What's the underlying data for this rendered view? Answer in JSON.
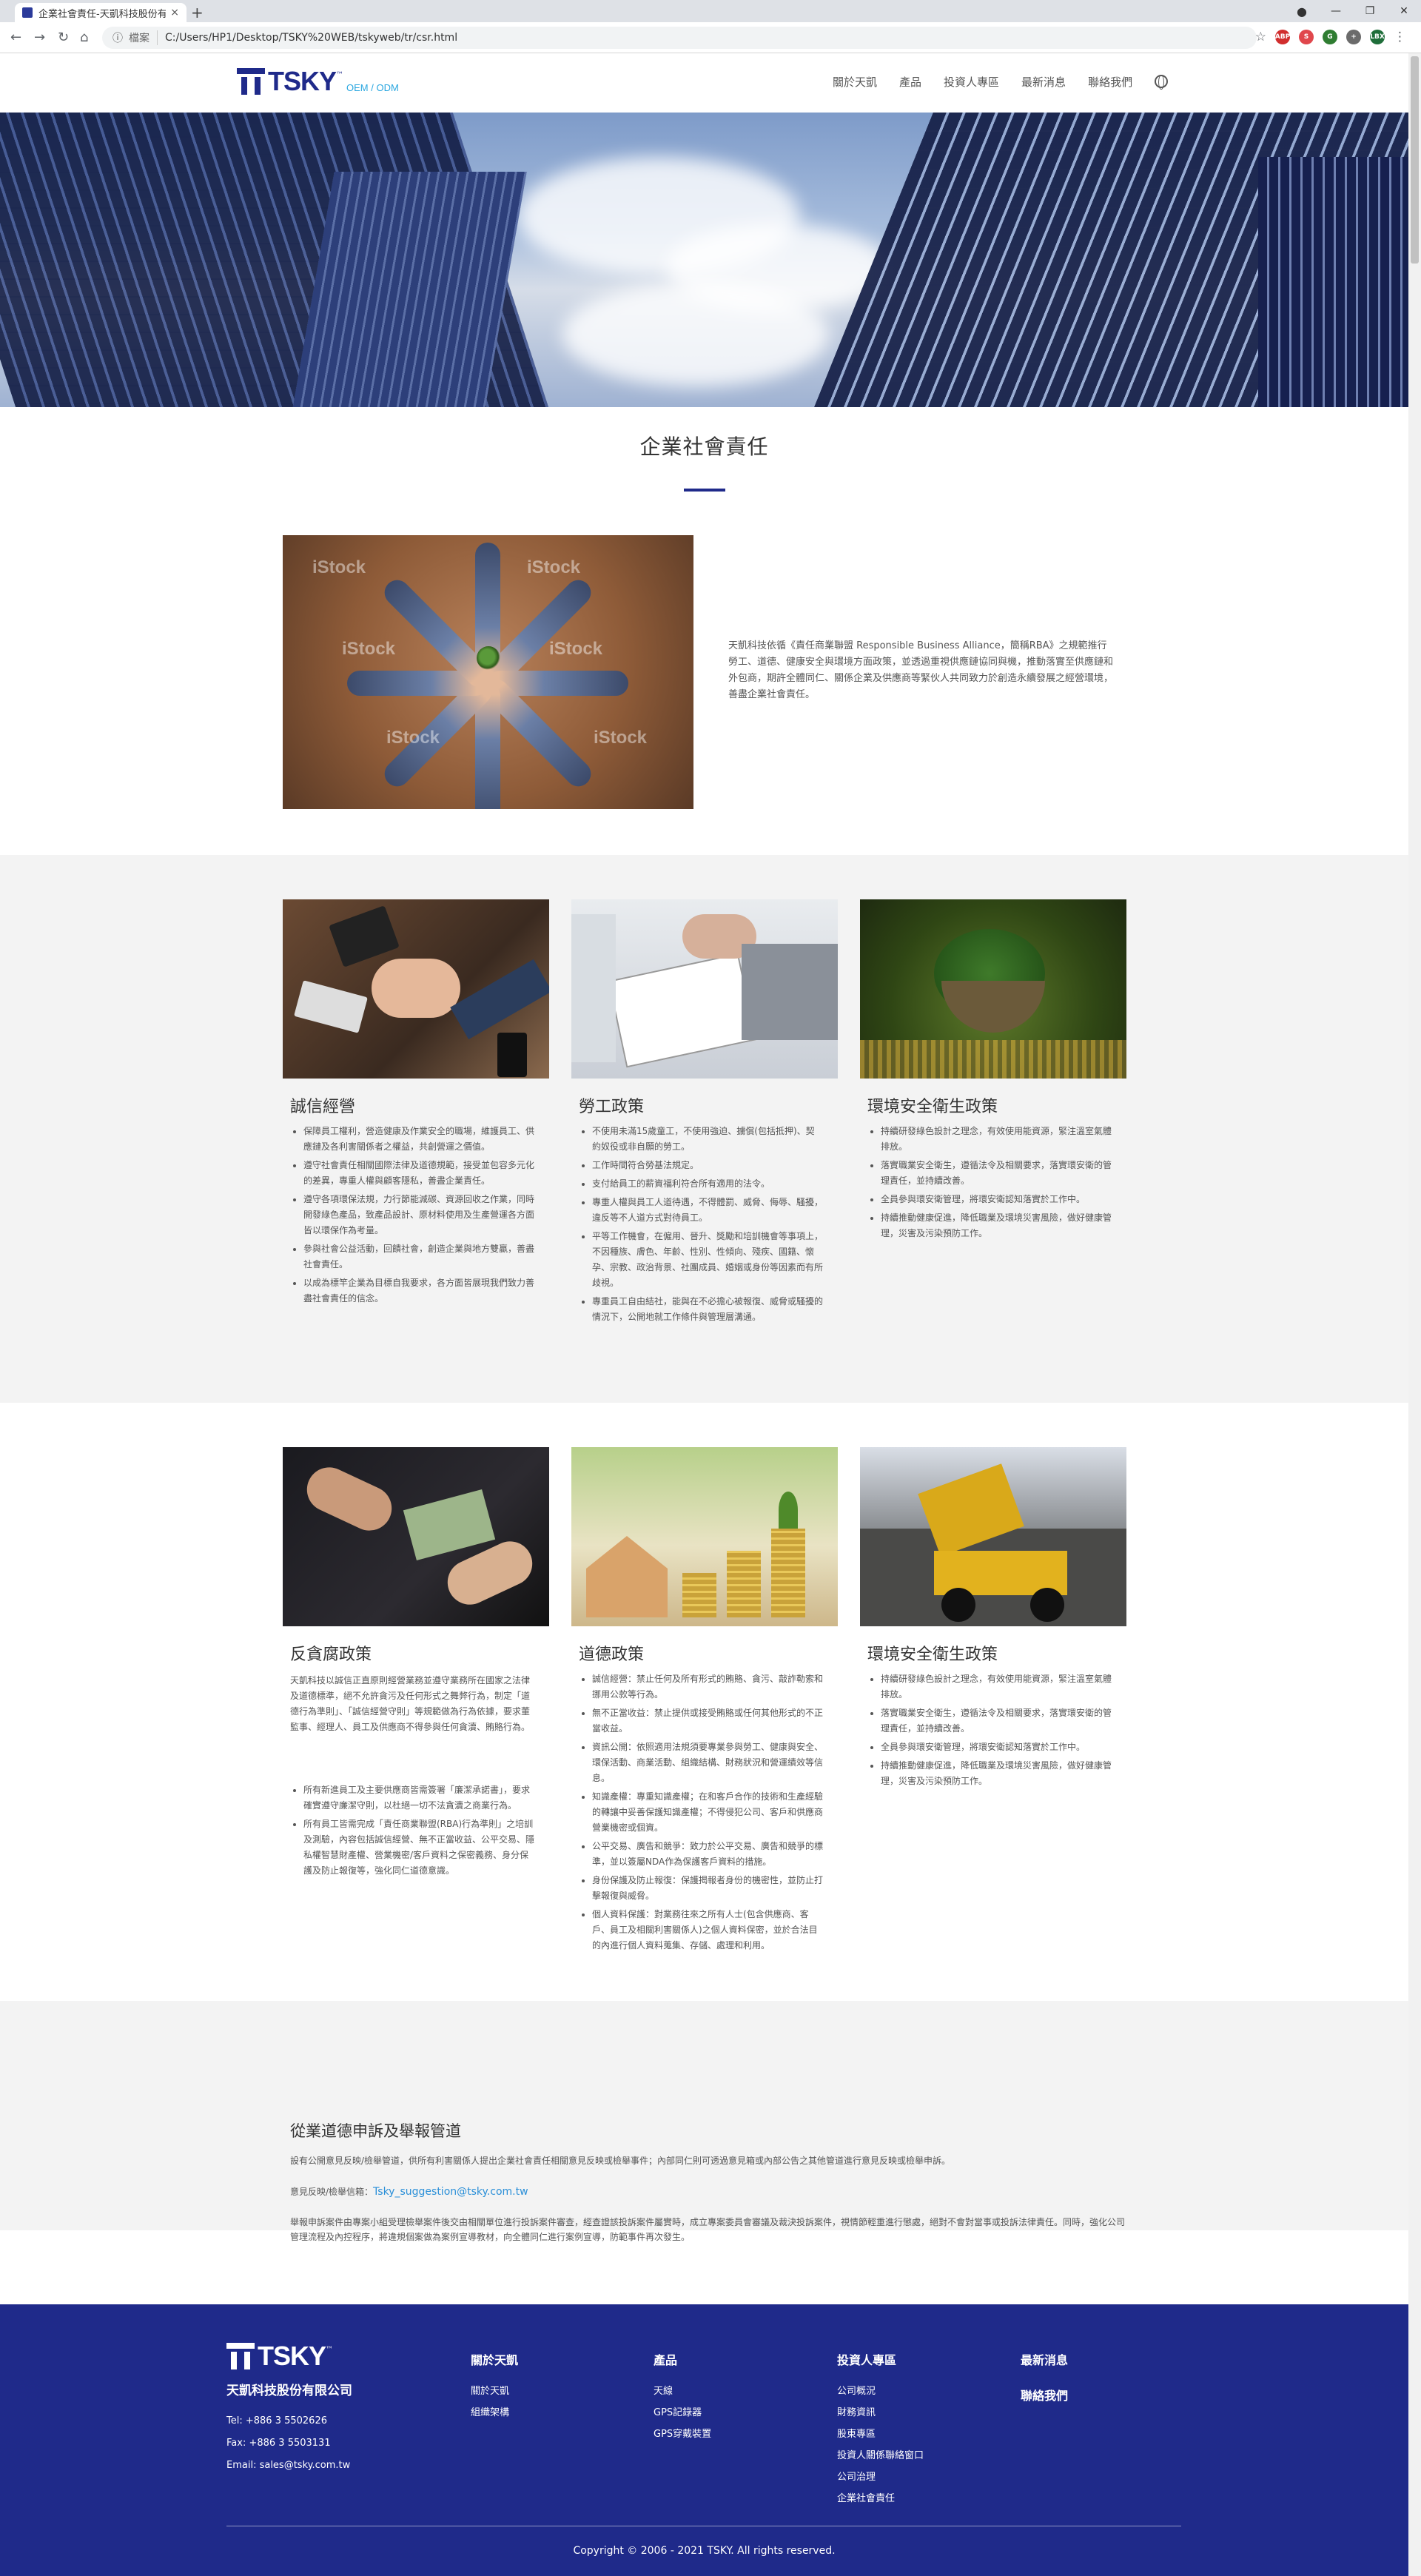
{
  "browser": {
    "tab_title": "企業社會責任-天凱科技股份有限",
    "tab_close": "×",
    "new_tab": "+",
    "site_label": "檔案",
    "url": "C:/Users/HP1/Desktop/TSKY%20WEB/tskyweb/tr/csr.html",
    "extensions": [
      {
        "name": "ABP",
        "color": "#d12e2e"
      },
      {
        "name": "S",
        "color": "#e0474c"
      },
      {
        "name": "G",
        "color": "#2f7d32"
      },
      {
        "name": "+",
        "color": "#6b6b6b"
      },
      {
        "name": "LBX",
        "color": "#1f6e3a"
      }
    ]
  },
  "header": {
    "logo_text": "TSKY",
    "logo_tm": "™",
    "logo_sub": "OEM / ODM",
    "nav": [
      "關於天凱",
      "產品",
      "投資人專區",
      "最新消息",
      "聯絡我們"
    ]
  },
  "hero": {
    "watermark": "iStock"
  },
  "page_title": "企業社會責任",
  "intro": {
    "text": "天凱科技依循《責任商業聯盟 Responsible Business Alliance，簡稱RBA》之規範推行勞工、道德、健康安全與環境方面政策，並透過重視供應鏈協同與機，推動落實至供應鏈和外包商，期許全體同仁、關係企業及供應商等緊伙人共同致力於創造永續發展之經營環境，善盡企業社會責任。"
  },
  "cards_row1": [
    {
      "title": "誠信經營",
      "items": [
        "保障員工權利，營造健康及作業安全的職場，維護員工、供應鏈及各利害關係者之權益，共創營運之價值。",
        "遵守社會責任相關國際法律及道德規範，接受並包容多元化的差異，專重人權與顧客隱私，善盡企業責任。",
        "遵守各項環保法規，力行節能減碳、資源回收之作業，同時開發綠色產品，致產品設計、原材料使用及生產營運各方面皆以環保作為考量。",
        "參與社會公益活動，回饋社會，創造企業與地方雙贏，善盡社會責任。",
        "以成為標竿企業為目標自我要求，各方面皆展現我們致力善盡社會責任的信念。"
      ]
    },
    {
      "title": "勞工政策",
      "items": [
        "不使用未滿15歲童工，不使用強迫、擄償(包括抵押)、契約奴役或非自願的勞工。",
        "工作時間符合勞基法規定。",
        "支付給員工的薪資福利符合所有適用的法令。",
        "專重人權與員工人道待遇，不得體罰、威脅、侮辱、騷擾，違反等不人道方式對待員工。",
        "平等工作機會，在僱用、晉升、獎勵和培訓機會等事項上，不因種族、膚色、年齡、性別、性傾向、殘疾、國籍、懷孕、宗教、政治背景、社團成員、婚姻或身份等因素而有所歧視。",
        "專重員工自由結社，能與在不必擔心被報復、威脅或騷擾的情況下，公開地就工作條件與管理層溝通。"
      ]
    },
    {
      "title": "環境安全衛生政策",
      "items": [
        "持續研發綠色設計之理念，有效使用能資源，緊注溫室氣體排放。",
        "落實職業安全衛生，遵循法令及相關要求，落實環安衛的管理責任，並持續改善。",
        "全員參與環安衛管理，將環安衛認知落實於工作中。",
        "持續推動健康促進，降低職業及環境災害風險，做好健康管理，災害及污染預防工作。"
      ]
    }
  ],
  "cards_row2": [
    {
      "title": "反貪腐政策",
      "paragraph": "天凱科技以誠信正直原則經營業務並遵守業務所在國家之法律及道德標準，絕不允許貪污及任何形式之舞弊行為，制定「道德行為準則」、「誠信經營守則」等規範做為行為依據，要求董監事、經理人、員工及供應商不得參與任何貪瀆、賄賂行為。",
      "items": [
        "所有新進員工及主要供應商皆需簽署「廉潔承諾書」，要求確實遵守廉潔守則，以杜絕一切不法貪瀆之商業行為。",
        "所有員工皆需完成「責任商業聯盟(RBA)行為準則」之培訓及測驗，內容包括誠信經營、無不正當收益、公平交易、隱私權智慧財產權、營業機密/客戶資料之保密義務、身分保護及防止報復等，強化同仁道德意識。"
      ]
    },
    {
      "title": "道德政策",
      "items": [
        "誠信經營：禁止任何及所有形式的賄賂、貪污、敲詐勒索和挪用公款等行為。",
        "無不正當收益：禁止提供或接受賄賂或任何其他形式的不正當收益。",
        "資訊公開：依照適用法規須要專業參與勞工、健康與安全、環保活動、商業活動、組織結構、財務狀況和營運績效等信息。",
        "知識產權：專重知識產權；在和客戶合作的技術和生產經驗的轉讓中妥善保護知識產權；不得侵犯公司、客戶和供應商營業機密或個資。",
        "公平交易、廣告和競爭：致力於公平交易、廣告和競爭的標準，並以簽屬NDA作為保護客戶資料的措施。",
        "身份保護及防止報復：保護揭報者身份的機密性，並防止打擊報復與威脅。",
        "個人資料保護：對業務往來之所有人士(包含供應商、客戶、員工及相關利害關係人)之個人資料保密，並於合法目的內進行個人資料蒐集、存儲、處理和利用。"
      ]
    },
    {
      "title": "環境安全衛生政策",
      "items": [
        "持續研發綠色設計之理念，有效使用能資源，緊注溫室氣體排放。",
        "落實職業安全衛生，遵循法令及相關要求，落實環安衛的管理責任，並持續改善。",
        "全員參與環安衛管理，將環安衛認知落實於工作中。",
        "持續推動健康促進，降低職業及環境災害風險，做好健康管理，災害及污染預防工作。"
      ]
    }
  ],
  "grievance": {
    "title": "從業道德申訴及舉報管道",
    "p1": "設有公開意見反映/檢舉管道，供所有利害關係人提出企業社會責任相關意見反映或檢舉事件；內部同仁則可透過意見箱或內部公告之其他管道進行意見反映或檢舉申訴。",
    "email_label": "意見反映/檢舉信箱：",
    "email": "Tsky_suggestion@tsky.com.tw",
    "p2": "舉報申訴案件由專案小組受理檢舉案件後交由相關單位進行投訴案件審查，經查證該投訴案件屬實時，成立專案委員會審議及裁決投訴案件，視情節輕重進行懲處，絕對不會對當事或投訴法律責任。同時，強化公司管理流程及內控程序，將違規個案做為案例宣導教材，向全體同仁進行案例宣導，防範事件再次發生。"
  },
  "footer": {
    "logo_text": "TSKY",
    "logo_tm": "™",
    "company": "天凱科技股份有限公司",
    "tel": "Tel: +886 3 5502626",
    "fax": "Fax: +886 3 5503131",
    "email": "Email: sales@tsky.com.tw",
    "columns": [
      {
        "head": "關於天凱",
        "items": [
          "關於天凱",
          "組織架構"
        ]
      },
      {
        "head": "產品",
        "items": [
          "天線",
          "GPS記錄器",
          "GPS穿戴裝置"
        ]
      },
      {
        "head": "投資人專區",
        "items": [
          "公司概況",
          "財務資訊",
          "股東專區",
          "投資人關係聯絡窗口",
          "公司治理",
          "企業社會責任"
        ]
      },
      {
        "head": "最新消息",
        "items": []
      },
      {
        "head": "聯絡我們",
        "items": []
      }
    ],
    "copyright": "Copyright © 2006 - 2021 TSKY. All rights reserved."
  }
}
